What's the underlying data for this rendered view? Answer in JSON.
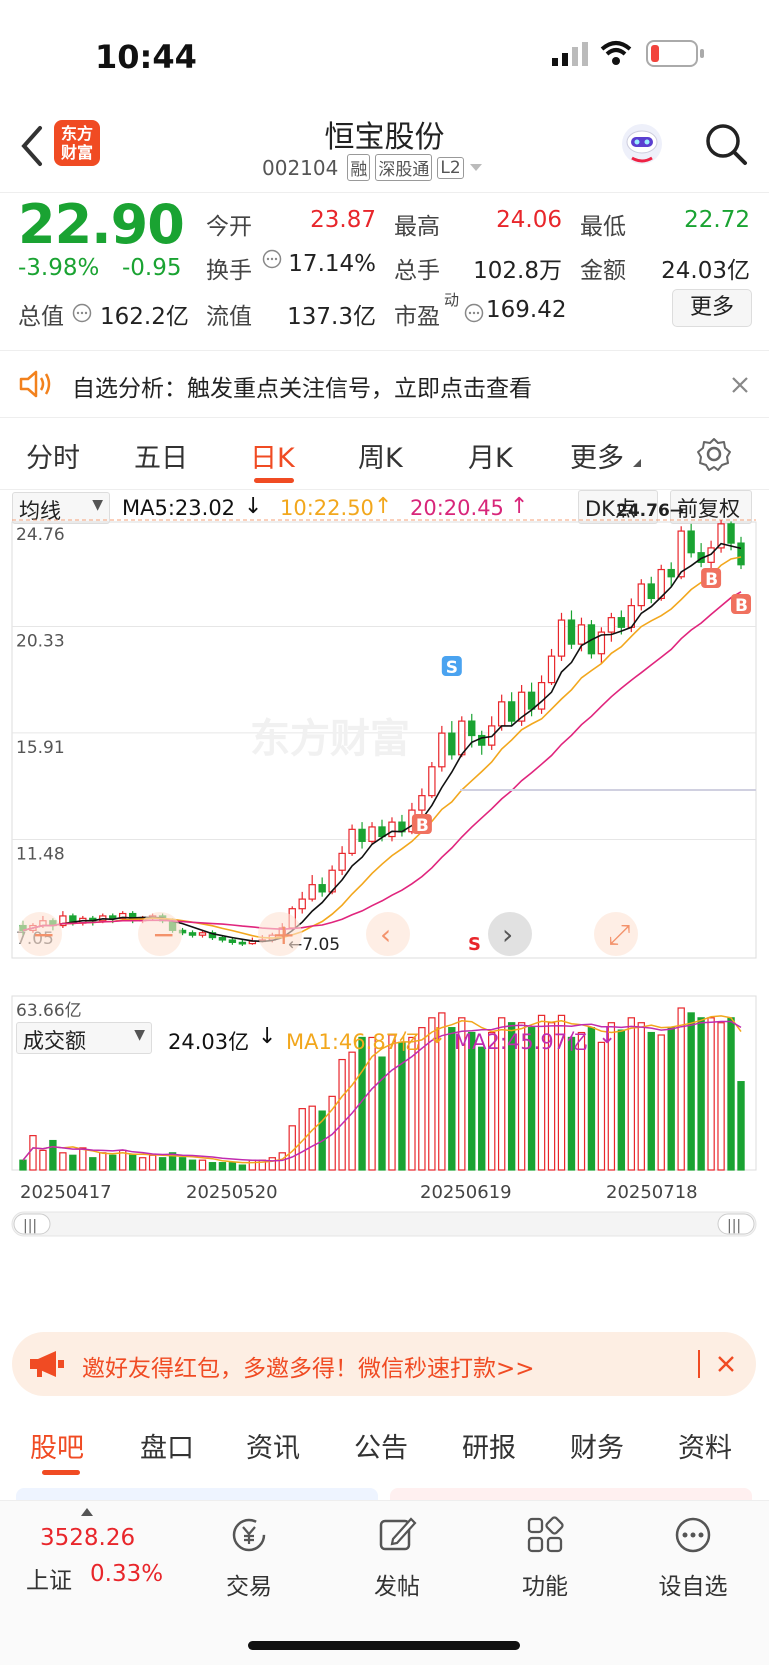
{
  "status_bar": {
    "time": "10:44"
  },
  "header": {
    "back_icon": "chevron-left-icon",
    "logo_text": "东方\n财富",
    "title": "恒宝股份",
    "code": "002104",
    "tags": [
      "融",
      "深股通",
      "L2"
    ],
    "robot_icon": "robot-avatar-icon",
    "search_icon": "search-icon"
  },
  "quote": {
    "price": "22.90",
    "change_pct": "-3.98%",
    "change": "-0.95",
    "rows": [
      [
        {
          "label": "今开",
          "value": "23.87",
          "color": "#e8262b"
        },
        {
          "label": "最高",
          "value": "24.06",
          "color": "#e8262b"
        },
        {
          "label": "最低",
          "value": "22.72",
          "color": "#1aa332"
        }
      ],
      [
        {
          "label": "换手",
          "value": "17.14%",
          "color": "#222"
        },
        {
          "label": "总手",
          "value": "102.8万",
          "color": "#222"
        },
        {
          "label": "金额",
          "value": "24.03亿",
          "color": "#222"
        }
      ],
      [
        {
          "label": "总值",
          "value": "162.2亿",
          "color": "#222"
        },
        {
          "label": "流值",
          "value": "137.3亿",
          "color": "#222"
        },
        {
          "label": "市盈",
          "value": "169.42",
          "color": "#222",
          "sup": "动"
        }
      ]
    ],
    "more_label": "更多"
  },
  "banner": {
    "text": "自选分析：触发重点关注信号，立即点击查看"
  },
  "tabs": [
    "分时",
    "五日",
    "日K",
    "周K",
    "月K",
    "更多"
  ],
  "active_tab": "日K",
  "chart_controls": {
    "ma_select": "均线",
    "ma5": "MA5:23.02",
    "ma10": "10:22.50",
    "ma20": "20:20.45",
    "dk": "DK点",
    "adjust": "前复权",
    "volume_select": "成交额",
    "vol_value": "24.03亿",
    "vol_ma1": "MA1:46.87亿",
    "vol_ma2": "MA2:45.97亿"
  },
  "chart_data": {
    "type": "candlestick",
    "price_ticks": [
      "24.76",
      "20.33",
      "15.91",
      "11.48",
      "7.05"
    ],
    "high_marker": "24.76",
    "low_marker": "7.05",
    "volume_max_label": "63.66亿",
    "dates": [
      "20250417",
      "20250520",
      "20250619",
      "20250718"
    ],
    "ylim": [
      7.05,
      24.76
    ],
    "candles": [
      [
        7.9,
        7.7,
        8.1,
        7.5
      ],
      [
        7.7,
        7.9,
        8.0,
        7.6
      ],
      [
        7.9,
        8.1,
        8.3,
        7.8
      ],
      [
        8.1,
        7.9,
        8.2,
        7.7
      ],
      [
        7.9,
        8.3,
        8.5,
        7.8
      ],
      [
        8.3,
        8.0,
        8.4,
        7.9
      ],
      [
        8.0,
        8.2,
        8.3,
        7.9
      ],
      [
        8.2,
        8.1,
        8.3,
        7.9
      ],
      [
        8.1,
        8.3,
        8.4,
        8.0
      ],
      [
        8.3,
        8.2,
        8.4,
        8.0
      ],
      [
        8.2,
        8.4,
        8.5,
        8.1
      ],
      [
        8.4,
        8.1,
        8.5,
        8.0
      ],
      [
        8.1,
        8.2,
        8.3,
        8.0
      ],
      [
        8.2,
        8.3,
        8.4,
        8.1
      ],
      [
        8.3,
        8.1,
        8.4,
        8.0
      ],
      [
        8.1,
        7.7,
        8.2,
        7.6
      ],
      [
        7.7,
        7.6,
        7.8,
        7.5
      ],
      [
        7.6,
        7.5,
        7.7,
        7.4
      ],
      [
        7.5,
        7.6,
        7.7,
        7.4
      ],
      [
        7.6,
        7.4,
        7.7,
        7.3
      ],
      [
        7.4,
        7.3,
        7.5,
        7.2
      ],
      [
        7.3,
        7.2,
        7.4,
        7.1
      ],
      [
        7.2,
        7.15,
        7.3,
        7.05
      ],
      [
        7.15,
        7.25,
        7.4,
        7.1
      ],
      [
        7.25,
        7.3,
        7.5,
        7.2
      ],
      [
        7.3,
        7.5,
        7.6,
        7.2
      ],
      [
        7.5,
        7.8,
        8.0,
        7.4
      ],
      [
        7.8,
        8.6,
        8.7,
        7.7
      ],
      [
        8.6,
        9.0,
        9.3,
        8.4
      ],
      [
        9.0,
        9.6,
        10.0,
        8.9
      ],
      [
        9.6,
        9.3,
        9.9,
        9.1
      ],
      [
        9.3,
        10.2,
        10.4,
        9.2
      ],
      [
        10.2,
        10.9,
        11.2,
        10.0
      ],
      [
        10.9,
        11.9,
        12.1,
        10.8
      ],
      [
        11.9,
        11.4,
        12.2,
        11.1
      ],
      [
        11.4,
        12.0,
        12.2,
        11.3
      ],
      [
        12.0,
        11.6,
        12.3,
        11.4
      ],
      [
        11.6,
        12.2,
        12.4,
        11.4
      ],
      [
        12.2,
        11.8,
        12.5,
        11.6
      ],
      [
        11.8,
        12.7,
        13.0,
        11.7
      ],
      [
        12.7,
        13.3,
        13.6,
        12.5
      ],
      [
        13.3,
        14.5,
        14.7,
        13.2
      ],
      [
        14.5,
        15.9,
        16.2,
        14.3
      ],
      [
        15.9,
        15.0,
        16.4,
        14.8
      ],
      [
        15.0,
        16.4,
        16.6,
        14.9
      ],
      [
        16.4,
        15.8,
        16.7,
        15.3
      ],
      [
        15.8,
        15.4,
        16.0,
        15.0
      ],
      [
        15.4,
        16.2,
        16.6,
        15.2
      ],
      [
        16.2,
        17.2,
        17.5,
        16.0
      ],
      [
        17.2,
        16.4,
        17.6,
        16.2
      ],
      [
        16.4,
        17.6,
        17.9,
        16.2
      ],
      [
        17.6,
        16.9,
        18.0,
        16.6
      ],
      [
        16.9,
        18.0,
        18.3,
        16.7
      ],
      [
        18.0,
        19.1,
        19.4,
        17.9
      ],
      [
        19.1,
        20.6,
        20.9,
        18.9
      ],
      [
        20.6,
        19.6,
        21.0,
        19.4
      ],
      [
        19.6,
        20.4,
        20.7,
        19.3
      ],
      [
        20.4,
        19.2,
        20.6,
        19.0
      ],
      [
        19.2,
        20.1,
        20.3,
        18.8
      ],
      [
        20.1,
        20.7,
        20.9,
        19.7
      ],
      [
        20.7,
        20.3,
        21.0,
        20.0
      ],
      [
        20.3,
        21.2,
        21.5,
        20.1
      ],
      [
        21.2,
        22.1,
        22.3,
        21.0
      ],
      [
        22.1,
        21.5,
        22.4,
        21.3
      ],
      [
        21.5,
        22.7,
        22.9,
        21.4
      ],
      [
        22.7,
        22.4,
        23.0,
        22.0
      ],
      [
        22.4,
        24.3,
        24.5,
        22.3
      ],
      [
        24.3,
        23.4,
        24.6,
        23.2
      ],
      [
        23.4,
        23.0,
        23.8,
        22.8
      ],
      [
        23.0,
        23.6,
        23.9,
        22.6
      ],
      [
        23.6,
        24.6,
        24.76,
        23.4
      ],
      [
        24.6,
        23.8,
        24.7,
        23.5
      ],
      [
        23.8,
        22.9,
        24.06,
        22.72
      ]
    ],
    "volumes": [
      4,
      14,
      8,
      12,
      7,
      6,
      9,
      5,
      7,
      6,
      8,
      6,
      5,
      6,
      5,
      7,
      5,
      4,
      4,
      3,
      3,
      3,
      2,
      4,
      4,
      5,
      7,
      18,
      25,
      26,
      24,
      30,
      45,
      48,
      54,
      54,
      46,
      55,
      52,
      54,
      58,
      62,
      64,
      58,
      62,
      56,
      50,
      56,
      62,
      60,
      60,
      58,
      63,
      60,
      63,
      54,
      56,
      58,
      52,
      60,
      57,
      62,
      60,
      56,
      55,
      58,
      66,
      64,
      62,
      62,
      60,
      62,
      36
    ],
    "ma_lines": [
      {
        "name": "MA5",
        "color": "#111111"
      },
      {
        "name": "MA10",
        "color": "#f2a71d"
      },
      {
        "name": "MA20",
        "color": "#e0257d"
      }
    ],
    "markers": [
      {
        "label": "S",
        "color": "#4aa3f0"
      },
      {
        "label": "B",
        "color": "#f0715f"
      }
    ]
  },
  "ad_banner": {
    "text": "邀好友得红包，多邀多得！微信秒速打款>>"
  },
  "bottom_tabs": [
    "股吧",
    "盘口",
    "资讯",
    "公告",
    "研报",
    "财务",
    "资料"
  ],
  "active_bottom_tab": "股吧",
  "footer": {
    "index_value": "3528.26",
    "index_name": "上证",
    "index_change": "0.33%",
    "items": [
      {
        "label": "交易",
        "icon": "yen-exchange-icon"
      },
      {
        "label": "发帖",
        "icon": "edit-icon"
      },
      {
        "label": "功能",
        "icon": "grid-icon"
      },
      {
        "label": "设自选",
        "icon": "more-dots-icon"
      }
    ]
  }
}
